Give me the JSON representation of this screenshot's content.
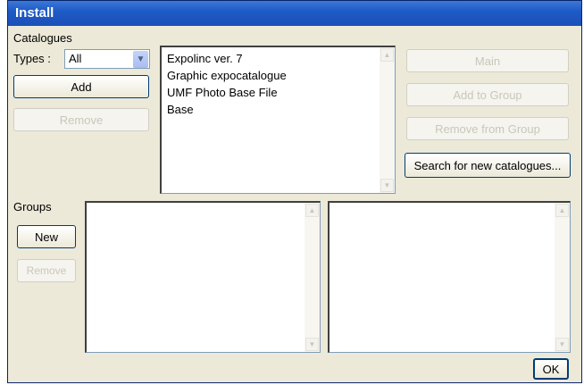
{
  "window": {
    "title": "Install"
  },
  "catalogues": {
    "heading": "Catalogues",
    "types_label": "Types :",
    "types_value": "All",
    "add_label": "Add",
    "remove_label": "Remove",
    "items": [
      "Expolinc ver. 7",
      "Graphic expocatalogue",
      "UMF Photo Base File",
      "Base"
    ]
  },
  "actions": {
    "main_label": "Main",
    "add_to_group_label": "Add to Group",
    "remove_from_group_label": "Remove from Group",
    "search_label": "Search for new catalogues..."
  },
  "groups": {
    "heading": "Groups",
    "new_label": "New",
    "remove_label": "Remove"
  },
  "footer": {
    "ok_label": "OK"
  }
}
